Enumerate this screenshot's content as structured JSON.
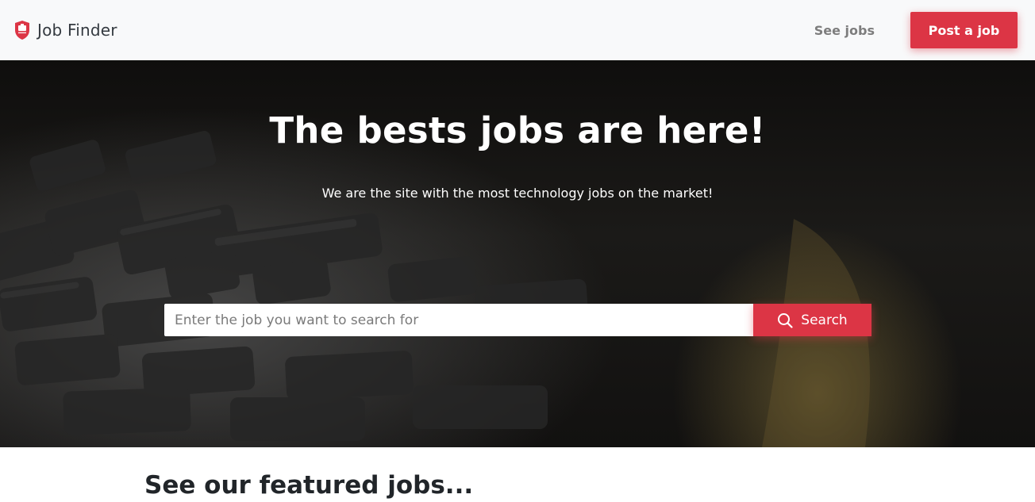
{
  "navbar": {
    "brand_name": "Job Finder",
    "brand_icon": "shield-icon",
    "links": {
      "see_jobs": "See jobs"
    },
    "post_job_label": "Post a job"
  },
  "hero": {
    "title": "The bests jobs are here!",
    "subtitle": "We are the site with the most technology jobs on the market!",
    "search": {
      "placeholder": "Enter the job you want to search for",
      "value": "",
      "button_label": "Search",
      "button_icon": "search-icon"
    }
  },
  "featured": {
    "title": "See our featured jobs..."
  },
  "colors": {
    "accent": "#dc3545",
    "navbar_bg": "#f8f9fa",
    "muted_link": "#7d7d7d",
    "heading": "#212529"
  }
}
